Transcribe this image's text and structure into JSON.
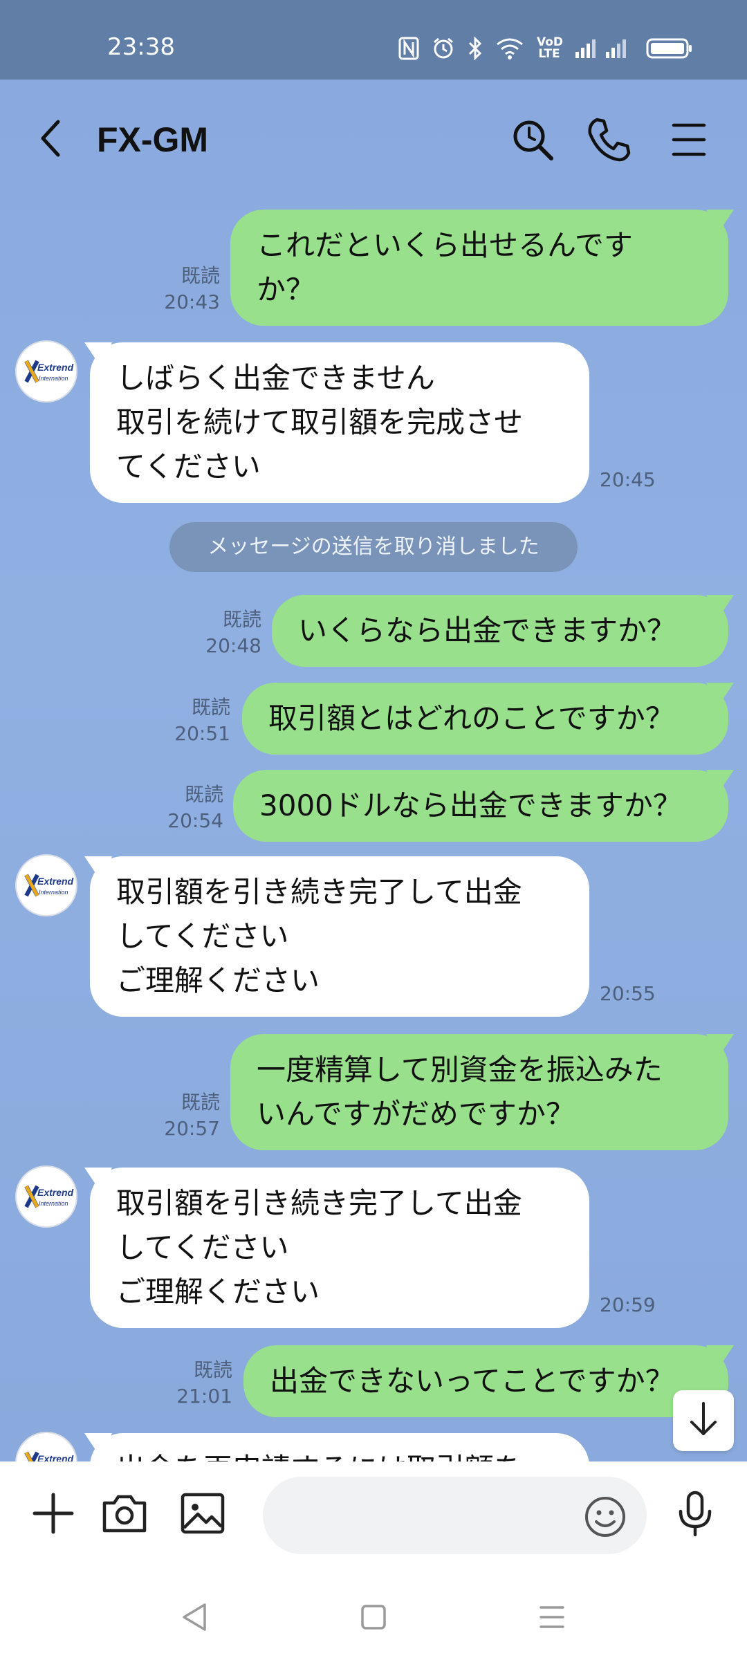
{
  "status_bar": {
    "time": "23:38",
    "network_label": "VoD LTE",
    "icons": [
      "nfc-icon",
      "alarm-icon",
      "bluetooth-icon",
      "wifi-icon",
      "signal-icon",
      "battery-icon"
    ]
  },
  "header": {
    "title": "FX-GM",
    "icons": [
      "back-icon",
      "search-icon",
      "phone-icon",
      "menu-icon"
    ]
  },
  "messages": [
    {
      "direction": "out",
      "text": "これだといくら出せるんです\nか？",
      "read": "既読",
      "time": "20:43"
    },
    {
      "direction": "in",
      "text": "しばらく出金できません\n取引を続けて取引額を完成させ\nてください",
      "time": "20:45"
    },
    {
      "direction": "out",
      "text": "いくらなら出金できますか？",
      "read": "既読",
      "time": "20:48"
    },
    {
      "direction": "out",
      "text": "取引額とはどれのことですか？",
      "read": "既読",
      "time": "20:51"
    },
    {
      "direction": "out",
      "text": "3000ドルなら出金できますか？",
      "read": "既読",
      "time": "20:54"
    },
    {
      "direction": "in",
      "text": "取引額を引き続き完了して出金\nしてください\nご理解ください",
      "time": "20:55"
    },
    {
      "direction": "out",
      "text": "一度精算して別資金を振込みた\nいんですがだめですか？",
      "read": "既読",
      "time": "20:57"
    },
    {
      "direction": "in",
      "text": "取引額を引き続き完了して出金\nしてください\nご理解ください",
      "time": "20:59"
    },
    {
      "direction": "out",
      "text": "出金できないってことですか？",
      "read": "既読",
      "time": "21:01"
    },
    {
      "direction": "in",
      "text": "出金を再申請するには取引額を"
    }
  ],
  "system_message": "メッセージの送信を取り消しました",
  "avatar_label": "Extrend",
  "avatar_sublabel": "Internation",
  "input_bar": {
    "placeholder": "",
    "icons": [
      "plus-icon",
      "camera-icon",
      "image-icon",
      "emoji-icon",
      "mic-icon"
    ]
  },
  "nav_bar": {
    "icons": [
      "nav-back-icon",
      "nav-home-icon",
      "nav-recents-icon"
    ]
  },
  "colors": {
    "status_bar": "#617ea7",
    "chat_background": "#8cabdc",
    "outgoing_bubble": "#98e08c",
    "incoming_bubble": "#ffffff",
    "system_pill": "#7a93b8"
  }
}
